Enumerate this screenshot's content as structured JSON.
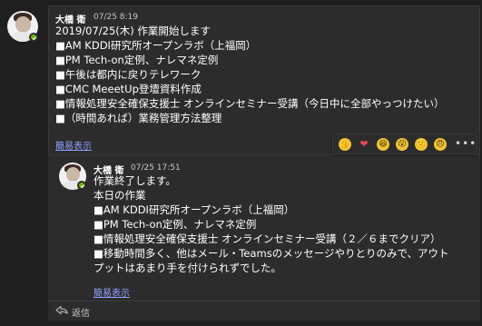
{
  "root_message": {
    "author": "大橋 衛",
    "timestamp": "07/25 8:19",
    "lines": [
      "2019/07/25(木) 作業開始します",
      "■AM KDDI研究所オープンラボ（上福岡）",
      "■PM Tech-on定例、ナレマネ定例",
      "■午後は都内に戻りテレワーク",
      "■CMC MeeetUp登壇資料作成",
      "■情報処理安全確保支援士 オンラインセミナー受講（今日中に全部やっつけたい）",
      "■（時間あれば）業務管理方法整理"
    ],
    "collapse_label": "簡易表示"
  },
  "reply_message": {
    "author": "大橋 衛",
    "timestamp": "07/25 17:51",
    "lines": [
      "作業終了します。",
      "本日の作業",
      "■AM KDDI研究所オープンラボ（上福岡）",
      "■PM Tech-on定例、ナレマネ定例",
      "■情報処理安全確保支援士 オンラインセミナー受講（２／６までクリア）",
      "■移動時間多く、他はメール・Teamsのメッセージやりとりのみで、アウト",
      "プットはあまり手を付けられずでした。"
    ],
    "collapse_label": "簡易表示"
  },
  "reactions": [
    {
      "name": "like",
      "icon": "thumbs-up-icon",
      "glyph": "👍",
      "color": "#f0c338"
    },
    {
      "name": "heart",
      "icon": "heart-icon",
      "glyph": "❤",
      "color": "#e74856"
    },
    {
      "name": "laugh",
      "icon": "laugh-icon",
      "glyph": "😆",
      "color": "#f0c338"
    },
    {
      "name": "surprised",
      "icon": "surprised-icon",
      "glyph": "😮",
      "color": "#f0c338"
    },
    {
      "name": "sad",
      "icon": "sad-icon",
      "glyph": "🙁",
      "color": "#f0c338"
    },
    {
      "name": "angry",
      "icon": "angry-icon",
      "glyph": "😠",
      "color": "#f0c338"
    }
  ],
  "more_label": "•••",
  "reply_label": "返信",
  "colors": {
    "background": "#1f1f1f",
    "card": "#2d2c2c",
    "link": "#8fa2ff",
    "presence": "#6bb700"
  }
}
